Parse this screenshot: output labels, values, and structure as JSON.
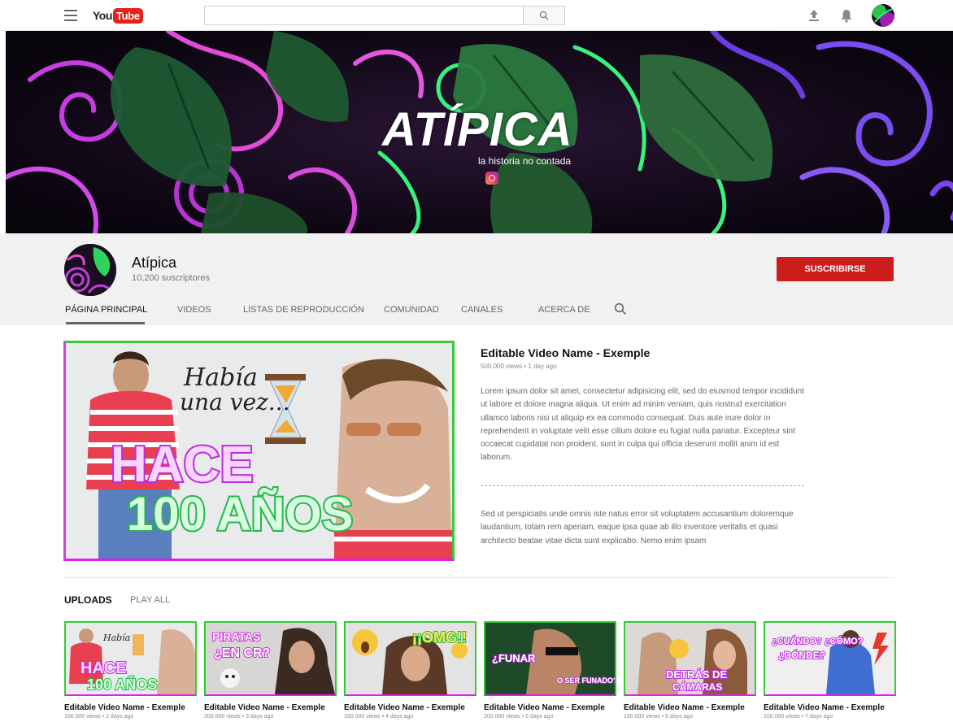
{
  "header": {
    "logo_you": "You",
    "logo_tube": "Tube",
    "search_placeholder": ""
  },
  "banner": {
    "brand_name": "ATÍPICA",
    "tagline": "la historia no contada"
  },
  "channel": {
    "name": "Atípica",
    "subscribers": "10,200 suscriptores",
    "subscribe_label": "SUSCRIBIRSE",
    "tabs": [
      "PÁGINA PRINCIPAL",
      "VIDEOS",
      "LISTAS DE REPRODUCCIÓN",
      "COMUNIDAD",
      "CANALES",
      "ACERCA DE"
    ]
  },
  "featured": {
    "title": "Editable Video Name - Exemple",
    "meta": "500.000 views • 1 day ago",
    "thumb_line1": "Había",
    "thumb_line2": "una vez...",
    "thumb_big1": "HACE",
    "thumb_big2": "100 AÑOS",
    "description_1": "Lorem ipsum dolor sit amet, consectetur adipisicing elit, sed do eiusmod tempor incididunt ut labore et dolore magna aliqua. Ut enim ad minim veniam, quis nostrud exercitation ullamco laboris nisi ut aliquip ex ea commodo consequat. Duis aute irure dolor in reprehenderit in voluptate velit esse cillum dolore eu fugiat nulla pariatur. Excepteur sint occaecat cupidatat non proident, sunt in culpa qui officia deserunt mollit anim id est laborum.",
    "description_2": "Sed ut perspiciatis unde omnis iste natus error sit voluptatem accusantium doloremque laudantium, totam rem aperiam, eaque ipsa quae ab illo inventore veritatis et quasi architecto beatae vitae dicta sunt explicabo. Nemo enim ipsam"
  },
  "uploads": {
    "heading": "UPLOADS",
    "play_all": "PLAY ALL",
    "videos": [
      {
        "title": "Editable Video Name - Exemple",
        "meta": "100.000 views • 2 days ago",
        "caption1": "HACE",
        "caption2": "100 AÑOS"
      },
      {
        "title": "Editable Video Name - Exemple",
        "meta": "200.000 views • 3 days ago",
        "caption1": "PIRATAS",
        "caption2": "¿EN CR?"
      },
      {
        "title": "Editable Video Name - Exemple",
        "meta": "100.000 views • 4 days ago",
        "caption1": "¡¡OMG!!",
        "caption2": ""
      },
      {
        "title": "Editable Video Name - Exemple",
        "meta": "200.000 views • 5 days ago",
        "caption1": "¿FUNAR",
        "caption2": "O SER FUNADO?"
      },
      {
        "title": "Editable Video Name - Exemple",
        "meta": "100.000 views • 6 days ago",
        "caption1": "DETRÁS DE",
        "caption2": "CÁMARAS"
      },
      {
        "title": "Editable Video Name - Exemple",
        "meta": "100.000 views • 7 days ago",
        "caption1": "¿CUÁNDO? ¿CÓMO?",
        "caption2": "¿DÓNDE?"
      }
    ]
  }
}
